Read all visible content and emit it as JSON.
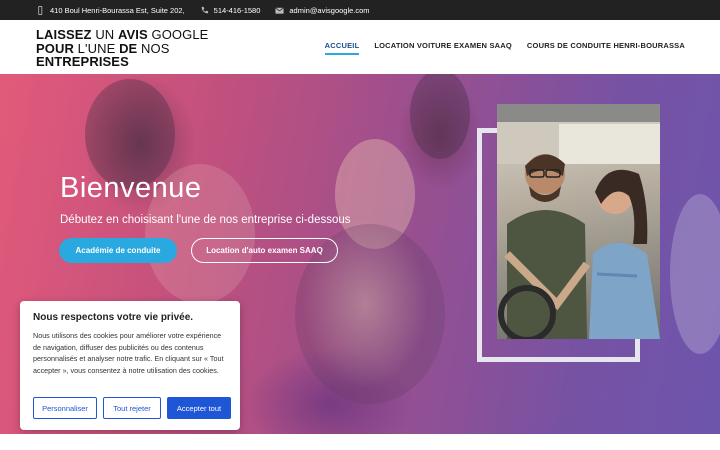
{
  "topbar": {
    "address": "410 Boul Henri-Bourassa Est, Suite 202,",
    "phone": "514-416-1580",
    "email": "admin@avisgoogle.com"
  },
  "logo": {
    "line1_bold": "LAISSEZ",
    "line1_mid": " UN ",
    "line1_bold2": "AVIS",
    "line1_end": " GOOGLE",
    "line2_bold": "POUR",
    "line2_mid": " L'UNE ",
    "line2_bold2": "DE",
    "line2_end": " NOS",
    "line3_bold": "ENTREPRISES"
  },
  "nav": {
    "items": [
      "ACCUEIL",
      "LOCATION VOITURE EXAMEN SAAQ",
      "COURS DE CONDUITE HENRI-BOURASSA"
    ],
    "active": "ACCUEIL"
  },
  "hero": {
    "title": "Bienvenue",
    "subtitle": "Débutez en choisisant l'une de nos entreprise ci-dessous",
    "button_primary": "Académie de conduite",
    "button_secondary": "Location d'auto examen SAAQ"
  },
  "cookie": {
    "title": "Nous respectons votre vie privée.",
    "text": "Nous utilisons des cookies pour améliorer votre expérience de navigation, diffuser des publicités ou des contenus personnalisés et analyser notre trafic. En cliquant sur « Tout accepter », vous consentez à notre utilisation des cookies.",
    "customize": "Personnaliser",
    "reject": "Tout rejeter",
    "accept": "Accepter tout"
  },
  "colors": {
    "accent_blue": "#2aa9e0",
    "cookie_blue": "#1e56d6",
    "topbar_bg": "#222222"
  },
  "icons": [
    "phone-icon",
    "mail-icon",
    "map-pin-icon"
  ]
}
